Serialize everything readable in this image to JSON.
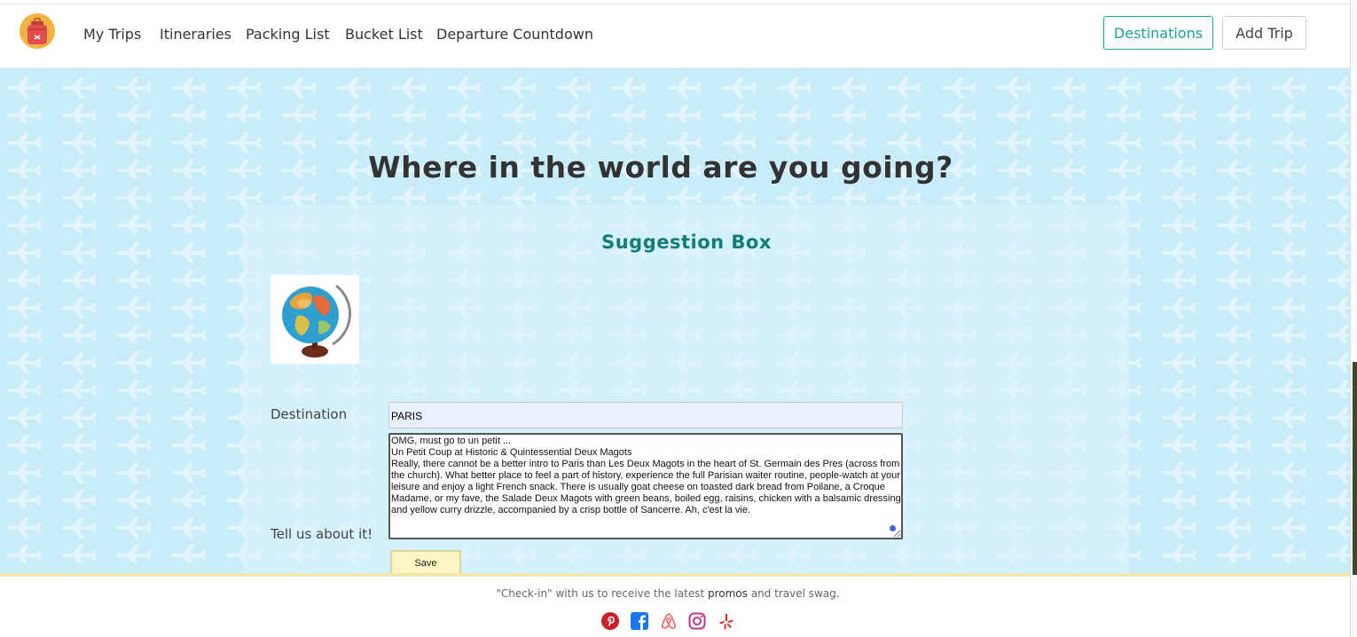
{
  "nav": {
    "links": [
      "My Trips",
      "Itineraries",
      "Packing List",
      "Bucket List",
      "Departure Countdown"
    ],
    "destinations_label": "Destinations",
    "add_trip_label": "Add Trip"
  },
  "main": {
    "headline": "Where in the world are you going?",
    "card_title": "Suggestion Box",
    "destination_label": "Destination",
    "destination_value": "PARIS",
    "story_label": "Tell us about it!",
    "story_value": "OMG, must go to un petit ...\nUn Petit Coup at Historic & Quintessential Deux Magots\nReally, there cannot be a better intro to Paris than Les Deux Magots in the heart of St. Germain des Pres (across from the church). What better place to feel a part of history, experience the full Parisian waiter routine, people-watch at your leisure and enjoy a light French snack. There is usually goat cheese on toasted dark bread from Poilane, a Croque Madame, or my fave, the Salade Deux Magots with green beans, boiled egg, raisins, chicken with a balsamic dressing and yellow curry drizzle, accompanied by a crisp bottle of Sancerre. Ah, c'est la vie.",
    "save_label": "Save"
  },
  "footer": {
    "text_before": "\"Check-in\" with us to receive the latest ",
    "text_promos": "promos",
    "text_after": " and travel swag.",
    "social_icons": [
      "pinterest-icon",
      "facebook-icon",
      "airbnb-icon",
      "instagram-icon",
      "yelp-icon"
    ]
  },
  "colors": {
    "accent": "#1aa595",
    "card_title": "#117c78",
    "background": "#c9ecf9",
    "save_button": "#fbf6c4",
    "footer_border": "#efe7a9",
    "pinterest": "#cb1f27",
    "facebook": "#1877f2",
    "airbnb": "#ff5a5f",
    "instagram": "#c13584",
    "yelp": "#d32323"
  }
}
